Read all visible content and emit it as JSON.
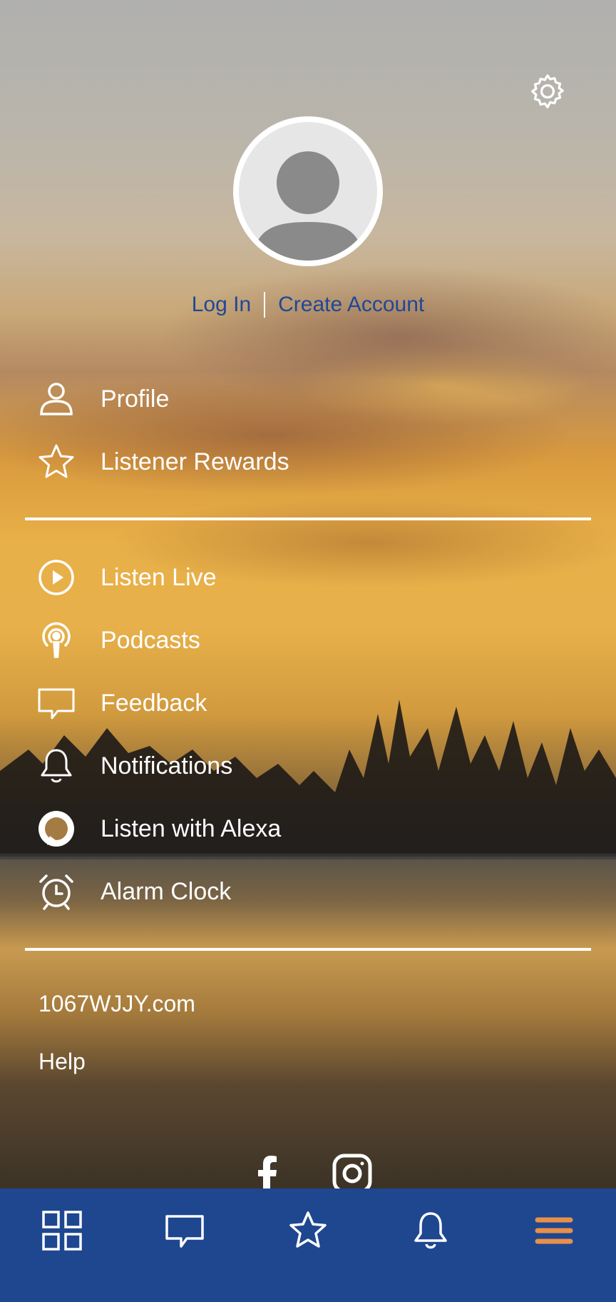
{
  "auth": {
    "login": "Log In",
    "create": "Create Account"
  },
  "menu_group_1": [
    {
      "label": "Profile",
      "icon": "person-icon"
    },
    {
      "label": "Listener Rewards",
      "icon": "star-icon"
    }
  ],
  "menu_group_2": [
    {
      "label": "Listen Live",
      "icon": "play-circle-icon"
    },
    {
      "label": "Podcasts",
      "icon": "podcast-icon"
    },
    {
      "label": "Feedback",
      "icon": "chat-icon"
    },
    {
      "label": "Notifications",
      "icon": "bell-icon"
    },
    {
      "label": "Listen with Alexa",
      "icon": "alexa-icon"
    },
    {
      "label": "Alarm Clock",
      "icon": "alarm-clock-icon"
    }
  ],
  "links": {
    "website": "1067WJJY.com",
    "help": "Help"
  },
  "social": [
    "facebook-icon",
    "instagram-icon"
  ],
  "tabbar": {
    "tabs": [
      "grid-icon",
      "chat-icon",
      "star-icon",
      "bell-icon",
      "menu-icon"
    ],
    "active_tab": "menu-icon",
    "background": "#1e4790",
    "active_color": "#e8904a"
  },
  "colors": {
    "link_blue": "#1f4896",
    "text": "#ffffff"
  }
}
